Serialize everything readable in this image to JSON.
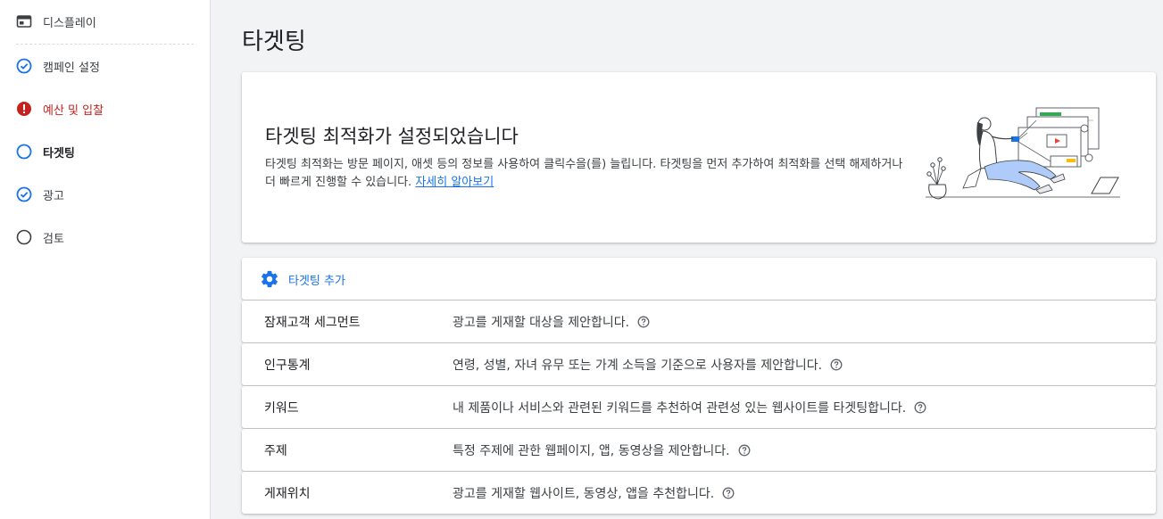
{
  "sidebar": {
    "items": [
      {
        "label": "디스플레이",
        "icon": "display-campaign-icon",
        "state": "normal"
      },
      {
        "label": "캠페인 설정",
        "icon": "check-circle-icon",
        "state": "done"
      },
      {
        "label": "예산 및 입찰",
        "icon": "error-circle-icon",
        "state": "error"
      },
      {
        "label": "타겟팅",
        "icon": "empty-circle-icon",
        "state": "active"
      },
      {
        "label": "광고",
        "icon": "check-circle-icon",
        "state": "done"
      },
      {
        "label": "검토",
        "icon": "empty-circle-icon",
        "state": "pending"
      }
    ]
  },
  "main": {
    "title": "타겟팅",
    "banner": {
      "heading": "타겟팅 최적화가 설정되었습니다",
      "description": "타겟팅 최적화는 방문 페이지, 애셋 등의 정보를 사용하여 클릭수을(를) 늘립니다. 타겟팅을 먼저 추가하여 최적화를 선택 해제하거나 더 빠르게 진행할 수 있습니다.",
      "link": "자세히 알아보기"
    },
    "add_targeting": {
      "label": "타겟팅 추가",
      "icon": "gear-icon"
    },
    "rows": [
      {
        "name": "잠재고객 세그먼트",
        "desc": "광고를 게재할 대상을 제안합니다."
      },
      {
        "name": "인구통계",
        "desc": "연령, 성별, 자녀 유무 또는 가계 소득을 기준으로 사용자를 제안합니다."
      },
      {
        "name": "키워드",
        "desc": "내 제품이나 서비스와 관련된 키워드를 추천하여 관련성 있는 웹사이트를 타겟팅합니다."
      },
      {
        "name": "주제",
        "desc": "특정 주제에 관한 웹페이지, 앱, 동영상을 제안합니다."
      },
      {
        "name": "게재위치",
        "desc": "광고를 게재할 웹사이트, 동영상, 앱을 추천합니다."
      }
    ]
  },
  "colors": {
    "accent": "#1a73e8",
    "error": "#c5221f",
    "background": "#f1f3f4"
  }
}
